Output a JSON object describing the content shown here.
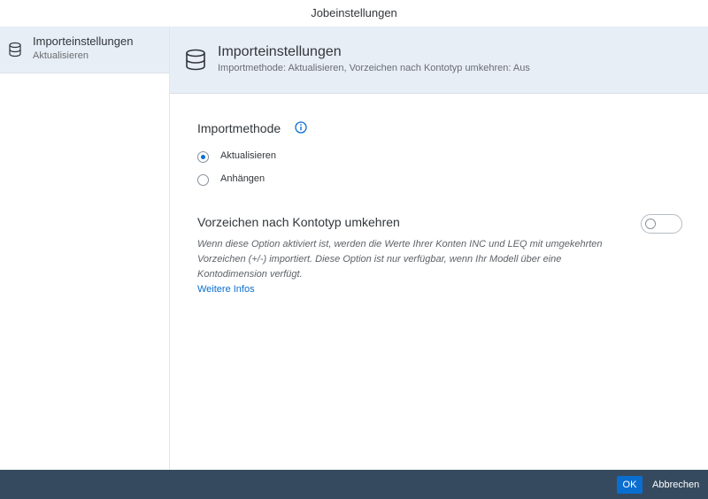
{
  "window": {
    "title": "Jobeinstellungen"
  },
  "sidebar": {
    "items": [
      {
        "label": "Importeinstellungen",
        "sublabel": "Aktualisieren",
        "icon": "database-icon"
      }
    ]
  },
  "header": {
    "icon": "database-icon",
    "title": "Importeinstellungen",
    "subtitle": "Importmethode: Aktualisieren, Vorzeichen nach Kontotyp umkehren: Aus"
  },
  "import_method": {
    "title": "Importmethode",
    "info_icon": "info-icon",
    "options": [
      {
        "label": "Aktualisieren",
        "selected": true
      },
      {
        "label": "Anhängen",
        "selected": false
      }
    ]
  },
  "reverse_sign": {
    "title": "Vorzeichen nach Kontotyp umkehren",
    "enabled": false,
    "description": "Wenn diese Option aktiviert ist, werden die Werte Ihrer Konten INC und LEQ mit umgekehrten Vorzeichen (+/-) importiert. Diese Option ist nur verfügbar, wenn Ihr Modell über eine Kontodimension verfügt.",
    "link": "Weitere Infos"
  },
  "footer": {
    "ok_label": "OK",
    "cancel_label": "Abbrechen"
  },
  "colors": {
    "accent": "#0a6ed1",
    "footer_bg": "#354a5f",
    "header_bg": "#e8eef6"
  }
}
